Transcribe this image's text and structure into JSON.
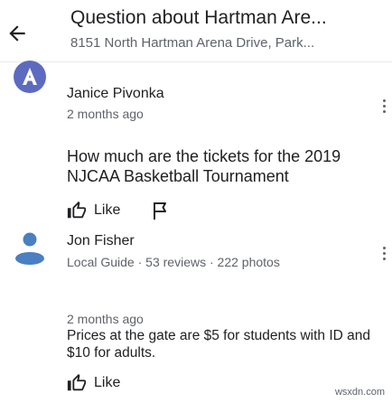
{
  "header": {
    "back_icon": "arrow-left-icon",
    "title": "Question about Hartman Are...",
    "subtitle": "8151 North Hartman Arena Drive, Park..."
  },
  "question": {
    "author": "Janice Pivonka",
    "time": "2 months ago",
    "avatar_icon": "user-initial-avatar-icon",
    "avatar_color": "#5c6bc0",
    "text": "How much are the tickets for the 2019 NJCAA Basketball Tournament",
    "like_label": "Like",
    "like_icon": "thumb-up-outline-icon",
    "flag_icon": "flag-outline-icon",
    "menu_icon": "more-vert-icon"
  },
  "answer": {
    "author": "Jon Fisher",
    "badge": "Local Guide",
    "reviews": "53 reviews",
    "photos": "222 photos",
    "separator": "·",
    "time": "2 months ago",
    "text": "Prices at the gate are $5 for students with ID and $10 for adults.",
    "like_label": "Like",
    "like_icon": "thumb-up-outline-icon",
    "avatar_icon": "person-avatar-icon",
    "avatar_color": "#4a7fc1",
    "menu_icon": "more-vert-icon"
  },
  "watermark": "wsxdn.com"
}
